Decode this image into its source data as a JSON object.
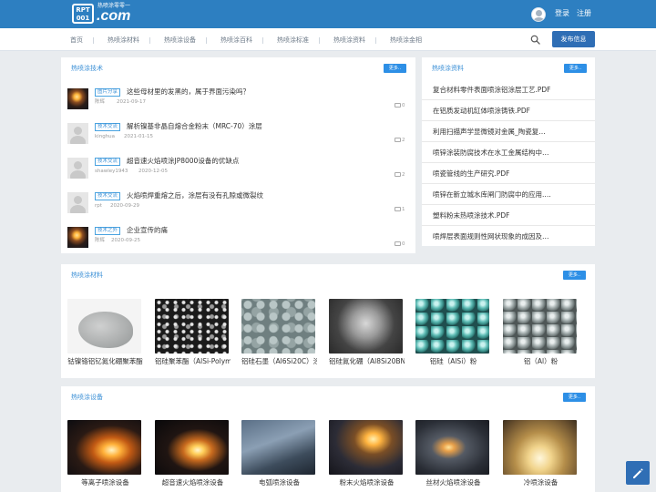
{
  "header": {
    "logo_top": "RPT",
    "logo_bottom": "001",
    "logo_domain": ".com",
    "logo_slogan": "热喷涂零零一",
    "login_label": "登录",
    "register_label": "注册",
    "user_icon": "user-avatar-icon"
  },
  "nav": {
    "items": [
      "首页",
      "热喷涂材料",
      "热喷涂设备",
      "热喷涂百科",
      "热喷涂标准",
      "热喷涂资料",
      "热喷涂金相"
    ],
    "search_icon": "search-icon",
    "publish_label": "发布信息"
  },
  "tech": {
    "title": "热喷涂技术",
    "more": "更多..",
    "articles": [
      {
        "tag": "图片分享",
        "title": "这些母材里的发黑的，属于界面污染吗？",
        "author": "陈辉",
        "date": "2021-09-17",
        "comments": "0",
        "thumb": "image"
      },
      {
        "tag": "技术交流",
        "title": "解析镍基非晶自熔合金粉末（MRC-70）涂层",
        "author": "kinghua",
        "date": "2021-01-15",
        "comments": "2",
        "thumb": "avatar"
      },
      {
        "tag": "技术交流",
        "title": "超音速火焰喷涂JP8000设备的优缺点",
        "author": "shawley1943",
        "date": "2020-12-05",
        "comments": "2",
        "thumb": "avatar"
      },
      {
        "tag": "技术交流",
        "title": "火焰喷焊重熔之后，涂层有没有孔隙或微裂纹",
        "author": "rpt",
        "date": "2020-09-29",
        "comments": "1",
        "thumb": "avatar"
      },
      {
        "tag": "技术之外",
        "title": "企业宣传的痛",
        "author": "陈辉",
        "date": "2020-09-25",
        "comments": "0",
        "thumb": "image"
      }
    ]
  },
  "docs": {
    "title": "热喷涂资料",
    "more": "更多..",
    "items": [
      "复合材料零件表面喷涂铝涂层工艺.PDF",
      "在铝质发动机缸体喷涂铸铁.PDF",
      "利用扫描声学显微镜对金属_陶瓷复…",
      "喷锌涂装防腐技术在水工金属结构中…",
      "喷瓷管线的生产研究.PDF",
      "喷锌在新立城水库闸门防腐中的应用.…",
      "塑料粉末热喷涂技术.PDF",
      "喷焊层表面规则性网状现象的成因及…"
    ]
  },
  "materials": {
    "title": "热喷涂材料",
    "more": "更多..",
    "items": [
      {
        "label": "钴镍铬铝钇氮化硼聚苯酯"
      },
      {
        "label": "铝硅聚苯酯（AlSi-Polyme"
      },
      {
        "label": "铝硅石墨（Al6Si20C）涂"
      },
      {
        "label": "铝硅氮化硼（Al8Si20BN"
      },
      {
        "label": "铝硅（AlSi）粉"
      },
      {
        "label": "铝（Al）粉"
      }
    ]
  },
  "equipment": {
    "title": "热喷涂设备",
    "more": "更多..",
    "items": [
      {
        "label": "等离子喷涂设备"
      },
      {
        "label": "超音速火焰喷涂设备"
      },
      {
        "label": "电弧喷涂设备"
      },
      {
        "label": "粉末火焰喷涂设备"
      },
      {
        "label": "丝材火焰喷涂设备"
      },
      {
        "label": "冷喷涂设备"
      }
    ]
  },
  "fab": {
    "icon": "edit-pencil-icon"
  },
  "colors": {
    "topbar": "#2d7fc1",
    "accent": "#3a8fd6",
    "publish": "#2f6eb5",
    "more": "#2d8fe6"
  }
}
